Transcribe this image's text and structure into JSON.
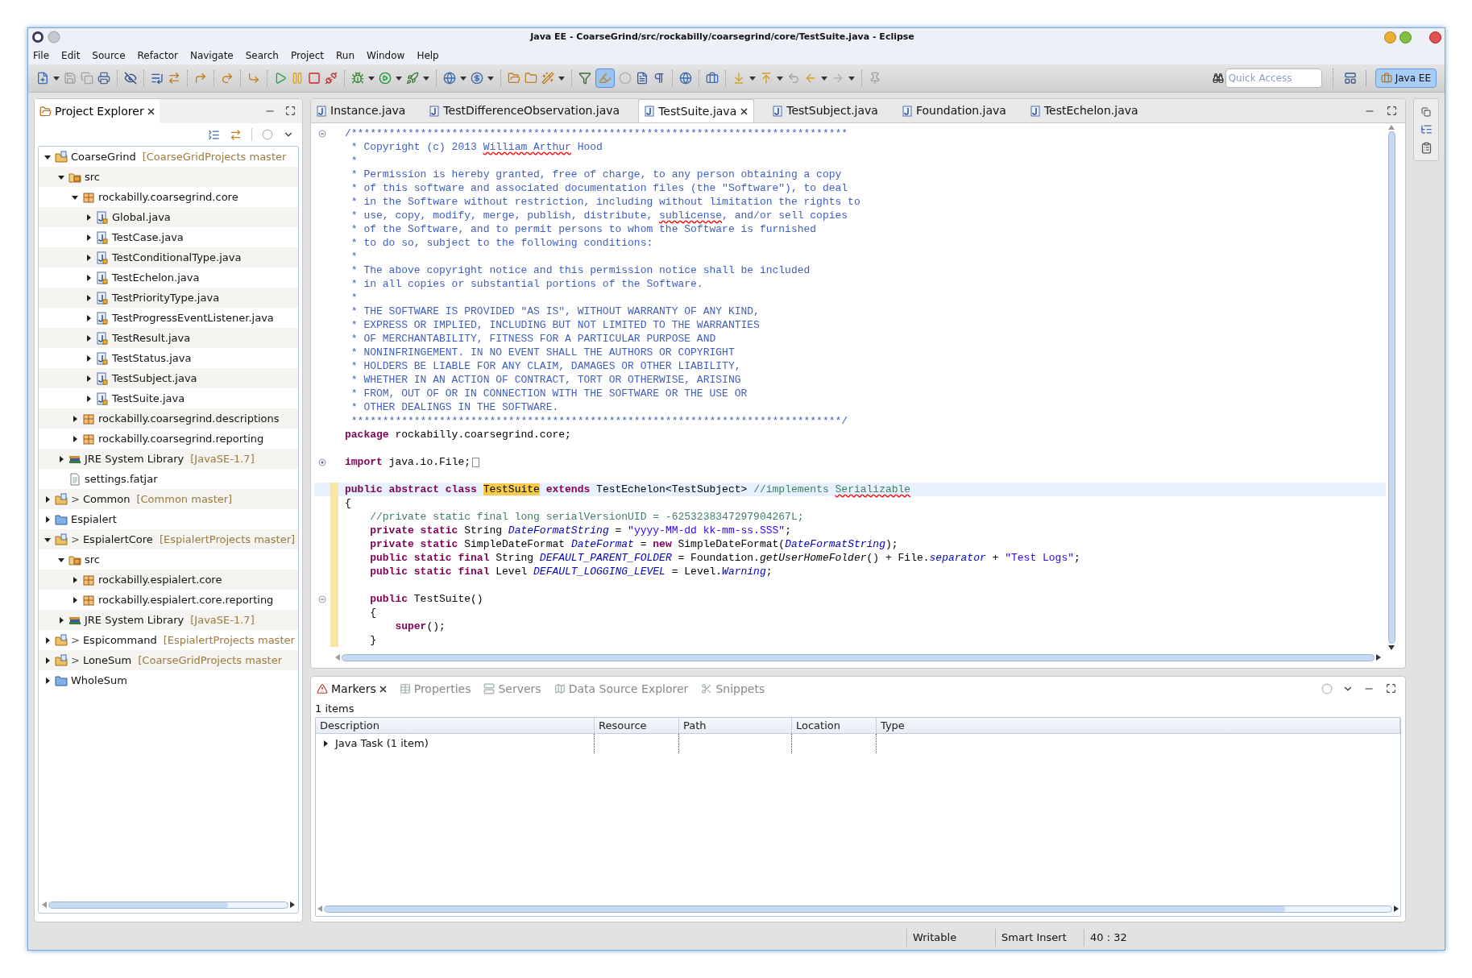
{
  "window": {
    "title": "Java EE - CoarseGrind/src/rockabilly/coarsegrind/core/TestSuite.java - Eclipse"
  },
  "menu": [
    "File",
    "Edit",
    "Source",
    "Refactor",
    "Navigate",
    "Search",
    "Project",
    "Run",
    "Window",
    "Help"
  ],
  "toolbar": {
    "toggle": {
      "selected": true
    },
    "quick_access": {
      "placeholder": "Quick Access"
    },
    "perspective": {
      "label": "Java EE",
      "selected": true
    }
  },
  "project_explorer": {
    "tab": {
      "label": "Project Explorer",
      "selected": true
    },
    "tree": [
      {
        "label": "CoarseGrind",
        "kind": "project",
        "decoration": "[CoarseGridProjects master",
        "expanded": true,
        "children": [
          {
            "label": "src",
            "kind": "source",
            "expanded": true,
            "children": [
              {
                "label": "rockabilly.coarsegrind.core",
                "kind": "package",
                "expanded": true,
                "children": [
                  {
                    "label": "Global.java",
                    "kind": "java",
                    "expanded": false
                  },
                  {
                    "label": "TestCase.java",
                    "kind": "java",
                    "expanded": false
                  },
                  {
                    "label": "TestConditionalType.java",
                    "kind": "java",
                    "expanded": false
                  },
                  {
                    "label": "TestEchelon.java",
                    "kind": "java",
                    "expanded": false
                  },
                  {
                    "label": "TestPriorityType.java",
                    "kind": "java",
                    "expanded": false
                  },
                  {
                    "label": "TestProgressEventListener.java",
                    "kind": "java",
                    "expanded": false
                  },
                  {
                    "label": "TestResult.java",
                    "kind": "java",
                    "expanded": false
                  },
                  {
                    "label": "TestStatus.java",
                    "kind": "java",
                    "expanded": false
                  },
                  {
                    "label": "TestSubject.java",
                    "kind": "java",
                    "expanded": false
                  },
                  {
                    "label": "TestSuite.java",
                    "kind": "java",
                    "expanded": false
                  }
                ]
              },
              {
                "label": "rockabilly.coarsegrind.descriptions",
                "kind": "package",
                "expanded": false
              },
              {
                "label": "rockabilly.coarsegrind.reporting",
                "kind": "package",
                "expanded": false
              }
            ]
          },
          {
            "label": "JRE System Library",
            "kind": "library",
            "decoration": "[JavaSE-1.7]",
            "expanded": false
          },
          {
            "label": "settings.fatjar",
            "kind": "file"
          }
        ]
      },
      {
        "label": "Common",
        "kind": "project",
        "prefix": ">",
        "decoration": "[Common master]",
        "expanded": false
      },
      {
        "label": "Espialert",
        "kind": "folder",
        "expanded": false
      },
      {
        "label": "EspialertCore",
        "kind": "project",
        "prefix": ">",
        "decoration": "[EspialertProjects master]",
        "expanded": true,
        "children": [
          {
            "label": "src",
            "kind": "source",
            "expanded": true,
            "children": [
              {
                "label": "rockabilly.espialert.core",
                "kind": "package",
                "expanded": false
              },
              {
                "label": "rockabilly.espialert.core.reporting",
                "kind": "package",
                "expanded": false
              }
            ]
          },
          {
            "label": "JRE System Library",
            "kind": "library",
            "decoration": "[JavaSE-1.7]",
            "expanded": false
          }
        ]
      },
      {
        "label": "Espicommand",
        "kind": "project",
        "prefix": ">",
        "decoration": "[EspialertProjects master",
        "expanded": false
      },
      {
        "label": "LoneSum",
        "kind": "project",
        "prefix": ">",
        "decoration": "[CoarseGridProjects master",
        "expanded": false
      },
      {
        "label": "WholeSum",
        "kind": "folder",
        "expanded": false
      }
    ]
  },
  "editor": {
    "tabs": [
      {
        "label": "Instance.java",
        "selected": false
      },
      {
        "label": "TestDifferenceObservation.java",
        "selected": false
      },
      {
        "label": "TestSuite.java",
        "selected": true
      },
      {
        "label": "TestSubject.java",
        "selected": false
      },
      {
        "label": "Foundation.java",
        "selected": false
      },
      {
        "label": "TestEchelon.java",
        "selected": false
      }
    ],
    "lines": [
      {
        "kind": "code",
        "expanded": true,
        "current": false,
        "range": false,
        "tokens": [
          {
            "kind": "doc",
            "t": "/*******************************************************************************"
          }
        ]
      },
      {
        "kind": "code",
        "current": false,
        "range": false,
        "tokens": [
          {
            "kind": "doc",
            "t": " * Copyright (c) 2013 "
          },
          {
            "kind": "doc_typo",
            "t": "William Arthur"
          },
          {
            "kind": "doc",
            "t": " Hood"
          }
        ]
      },
      {
        "kind": "code",
        "current": false,
        "range": false,
        "tokens": [
          {
            "kind": "doc",
            "t": " *"
          }
        ]
      },
      {
        "kind": "code",
        "current": false,
        "range": false,
        "tokens": [
          {
            "kind": "doc",
            "t": " * Permission is hereby granted, free of charge, to any person obtaining a copy"
          }
        ]
      },
      {
        "kind": "code",
        "current": false,
        "range": false,
        "tokens": [
          {
            "kind": "doc",
            "t": " * of this software and associated documentation files (the \"Software\"), to deal"
          }
        ]
      },
      {
        "kind": "code",
        "current": false,
        "range": false,
        "tokens": [
          {
            "kind": "doc",
            "t": " * in the Software without restriction, including without limitation the rights to"
          }
        ]
      },
      {
        "kind": "code",
        "current": false,
        "range": false,
        "tokens": [
          {
            "kind": "doc",
            "t": " * use, copy, modify, merge, publish, distribute, "
          },
          {
            "kind": "doc_typo",
            "t": "sublicense"
          },
          {
            "kind": "doc",
            "t": ", and/or sell copies"
          }
        ]
      },
      {
        "kind": "code",
        "current": false,
        "range": false,
        "tokens": [
          {
            "kind": "doc",
            "t": " * of the Software, and to permit persons to whom the Software is furnished"
          }
        ]
      },
      {
        "kind": "code",
        "current": false,
        "range": false,
        "tokens": [
          {
            "kind": "doc",
            "t": " * to do so, subject to the following conditions:"
          }
        ]
      },
      {
        "kind": "code",
        "current": false,
        "range": false,
        "tokens": [
          {
            "kind": "doc",
            "t": " *"
          }
        ]
      },
      {
        "kind": "code",
        "current": false,
        "range": false,
        "tokens": [
          {
            "kind": "doc",
            "t": " * The above copyright notice and this permission notice shall be included"
          }
        ]
      },
      {
        "kind": "code",
        "current": false,
        "range": false,
        "tokens": [
          {
            "kind": "doc",
            "t": " * in all copies or substantial portions of the Software."
          }
        ]
      },
      {
        "kind": "code",
        "current": false,
        "range": false,
        "tokens": [
          {
            "kind": "doc",
            "t": " *"
          }
        ]
      },
      {
        "kind": "code",
        "current": false,
        "range": false,
        "tokens": [
          {
            "kind": "doc",
            "t": " * THE SOFTWARE IS PROVIDED \"AS IS\", WITHOUT WARRANTY OF ANY KIND,"
          }
        ]
      },
      {
        "kind": "code",
        "current": false,
        "range": false,
        "tokens": [
          {
            "kind": "doc",
            "t": " * EXPRESS OR IMPLIED, INCLUDING BUT NOT LIMITED TO THE WARRANTIES"
          }
        ]
      },
      {
        "kind": "code",
        "current": false,
        "range": false,
        "tokens": [
          {
            "kind": "doc",
            "t": " * OF MERCHANTABILITY, FITNESS FOR A PARTICULAR PURPOSE AND"
          }
        ]
      },
      {
        "kind": "code",
        "current": false,
        "range": false,
        "tokens": [
          {
            "kind": "doc",
            "t": " * NONINFRINGEMENT. IN NO EVENT SHALL THE AUTHORS OR COPYRIGHT"
          }
        ]
      },
      {
        "kind": "code",
        "current": false,
        "range": false,
        "tokens": [
          {
            "kind": "doc",
            "t": " * HOLDERS BE LIABLE FOR ANY CLAIM, DAMAGES OR OTHER LIABILITY,"
          }
        ]
      },
      {
        "kind": "code",
        "current": false,
        "range": false,
        "tokens": [
          {
            "kind": "doc",
            "t": " * WHETHER IN AN ACTION OF CONTRACT, TORT OR OTHERWISE, ARISING"
          }
        ]
      },
      {
        "kind": "code",
        "current": false,
        "range": false,
        "tokens": [
          {
            "kind": "doc",
            "t": " * FROM, OUT OF OR IN CONNECTION WITH THE SOFTWARE OR THE USE OR"
          }
        ]
      },
      {
        "kind": "code",
        "current": false,
        "range": false,
        "tokens": [
          {
            "kind": "doc",
            "t": " * OTHER DEALINGS IN THE SOFTWARE."
          }
        ]
      },
      {
        "kind": "code",
        "current": false,
        "range": false,
        "tokens": [
          {
            "kind": "doc",
            "t": " ******************************************************************************/"
          }
        ]
      },
      {
        "kind": "code",
        "current": false,
        "range": false,
        "tokens": [
          {
            "kind": "kw",
            "t": "package"
          },
          {
            "kind": "plain",
            "t": " rockabilly.coarsegrind.core;"
          }
        ]
      },
      {
        "kind": "blank"
      },
      {
        "kind": "code",
        "expanded": false,
        "current": false,
        "range": false,
        "tokens": [
          {
            "kind": "kw",
            "t": "import"
          },
          {
            "kind": "plain",
            "t": " java.io.File;"
          }
        ]
      },
      {
        "kind": "blank"
      },
      {
        "kind": "code",
        "current": true,
        "range": true,
        "tokens": [
          {
            "kind": "kw",
            "t": "public abstract class "
          },
          {
            "kind": "occurrence",
            "t": "TestSuite"
          },
          {
            "kind": "kw",
            "t": " extends"
          },
          {
            "kind": "plain",
            "t": " TestEchelon<TestSubject> "
          },
          {
            "kind": "comment",
            "t": "//implements "
          },
          {
            "kind": "comment_typo",
            "t": "Serializable"
          }
        ]
      },
      {
        "kind": "code",
        "current": false,
        "range": true,
        "tokens": [
          {
            "kind": "plain",
            "t": "{"
          }
        ]
      },
      {
        "kind": "code",
        "current": false,
        "range": true,
        "tokens": [
          {
            "kind": "comment",
            "t": "    //private static final long serialVersionUID = -6253238347297904267L;"
          }
        ]
      },
      {
        "kind": "code",
        "current": false,
        "range": true,
        "tokens": [
          {
            "kind": "kw",
            "t": "    private static"
          },
          {
            "kind": "plain",
            "t": " String "
          },
          {
            "kind": "field",
            "t": "DateFormatString"
          },
          {
            "kind": "plain",
            "t": " = "
          },
          {
            "kind": "str",
            "t": "\"yyyy-MM-dd kk-mm-ss.SSS\""
          },
          {
            "kind": "plain",
            "t": ";"
          }
        ]
      },
      {
        "kind": "code",
        "current": false,
        "range": true,
        "tokens": [
          {
            "kind": "kw",
            "t": "    private static"
          },
          {
            "kind": "plain",
            "t": " SimpleDateFormat "
          },
          {
            "kind": "field",
            "t": "DateFormat"
          },
          {
            "kind": "plain",
            "t": " = "
          },
          {
            "kind": "kw",
            "t": "new"
          },
          {
            "kind": "plain",
            "t": " SimpleDateFormat("
          },
          {
            "kind": "field",
            "t": "DateFormatString"
          },
          {
            "kind": "plain",
            "t": ");"
          }
        ]
      },
      {
        "kind": "code",
        "current": false,
        "range": true,
        "tokens": [
          {
            "kind": "kw",
            "t": "    public static final"
          },
          {
            "kind": "plain",
            "t": " String "
          },
          {
            "kind": "field",
            "t": "DEFAULT_PARENT_FOLDER"
          },
          {
            "kind": "plain",
            "t": " = Foundation."
          },
          {
            "kind": "method",
            "t": "getUserHomeFolder"
          },
          {
            "kind": "plain",
            "t": "() + File."
          },
          {
            "kind": "field",
            "t": "separator"
          },
          {
            "kind": "plain",
            "t": " + "
          },
          {
            "kind": "str",
            "t": "\"Test Logs\""
          },
          {
            "kind": "plain",
            "t": ";"
          }
        ]
      },
      {
        "kind": "code",
        "current": false,
        "range": true,
        "tokens": [
          {
            "kind": "kw",
            "t": "    public static final"
          },
          {
            "kind": "plain",
            "t": " Level "
          },
          {
            "kind": "field",
            "t": "DEFAULT_LOGGING_LEVEL"
          },
          {
            "kind": "plain",
            "t": " = Level."
          },
          {
            "kind": "field",
            "t": "Warning"
          },
          {
            "kind": "plain",
            "t": ";"
          }
        ]
      },
      {
        "kind": "blank",
        "range": true
      },
      {
        "kind": "code",
        "expanded": true,
        "current": false,
        "range": true,
        "tokens": [
          {
            "kind": "kw",
            "t": "    public"
          },
          {
            "kind": "plain",
            "t": " TestSuite()"
          }
        ]
      },
      {
        "kind": "code",
        "current": false,
        "range": true,
        "tokens": [
          {
            "kind": "plain",
            "t": "    {"
          }
        ]
      },
      {
        "kind": "code",
        "current": false,
        "range": true,
        "tokens": [
          {
            "kind": "kw",
            "t": "        super"
          },
          {
            "kind": "plain",
            "t": "();"
          }
        ]
      },
      {
        "kind": "code",
        "current": false,
        "range": true,
        "tokens": [
          {
            "kind": "plain",
            "t": "    }"
          }
        ]
      }
    ]
  },
  "bottom_panel": {
    "tabs": [
      {
        "label": "Markers",
        "selected": true
      },
      {
        "label": "Properties",
        "selected": false
      },
      {
        "label": "Servers",
        "selected": false
      },
      {
        "label": "Data Source Explorer",
        "selected": false
      },
      {
        "label": "Snippets",
        "selected": false
      }
    ],
    "count": "1 items",
    "table": {
      "columns": [
        "Description",
        "Resource",
        "Path",
        "Location",
        "Type"
      ],
      "rows": [
        {
          "description": "Java Task (1 item)",
          "expanded": false
        }
      ]
    }
  },
  "status_bar": [
    "Writable",
    "Smart Insert",
    "40 : 32"
  ]
}
